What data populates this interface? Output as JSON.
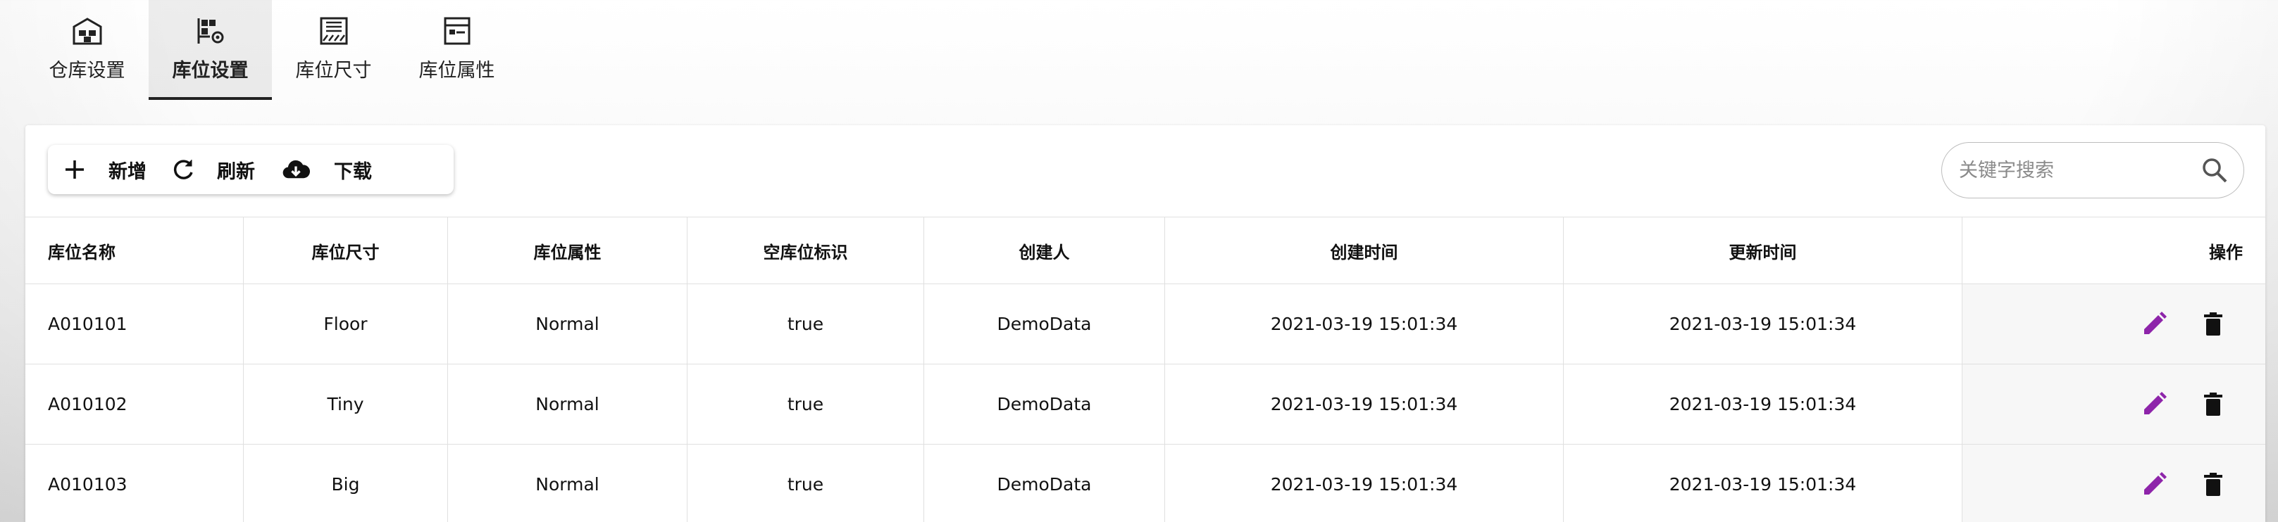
{
  "tabs": [
    {
      "label": "仓库设置",
      "icon": "warehouse-icon",
      "active": false
    },
    {
      "label": "库位设置",
      "icon": "location-settings-icon",
      "active": true
    },
    {
      "label": "库位尺寸",
      "icon": "location-size-icon",
      "active": false
    },
    {
      "label": "库位属性",
      "icon": "location-attribute-icon",
      "active": false
    }
  ],
  "toolbar": {
    "add_label": "新增",
    "refresh_label": "刷新",
    "download_label": "下载"
  },
  "search": {
    "placeholder": "关键字搜索",
    "value": ""
  },
  "table": {
    "columns": [
      "库位名称",
      "库位尺寸",
      "库位属性",
      "空库位标识",
      "创建人",
      "创建时间",
      "更新时间",
      "操作"
    ],
    "rows": [
      [
        "A010101",
        "Floor",
        "Normal",
        "true",
        "DemoData",
        "2021-03-19 15:01:34",
        "2021-03-19 15:01:34"
      ],
      [
        "A010102",
        "Tiny",
        "Normal",
        "true",
        "DemoData",
        "2021-03-19 15:01:34",
        "2021-03-19 15:01:34"
      ],
      [
        "A010103",
        "Big",
        "Normal",
        "true",
        "DemoData",
        "2021-03-19 15:01:34",
        "2021-03-19 15:01:34"
      ]
    ]
  },
  "colors": {
    "edit_icon": "#8e24aa",
    "delete_icon": "#111111",
    "active_tab_underline": "#222222"
  }
}
